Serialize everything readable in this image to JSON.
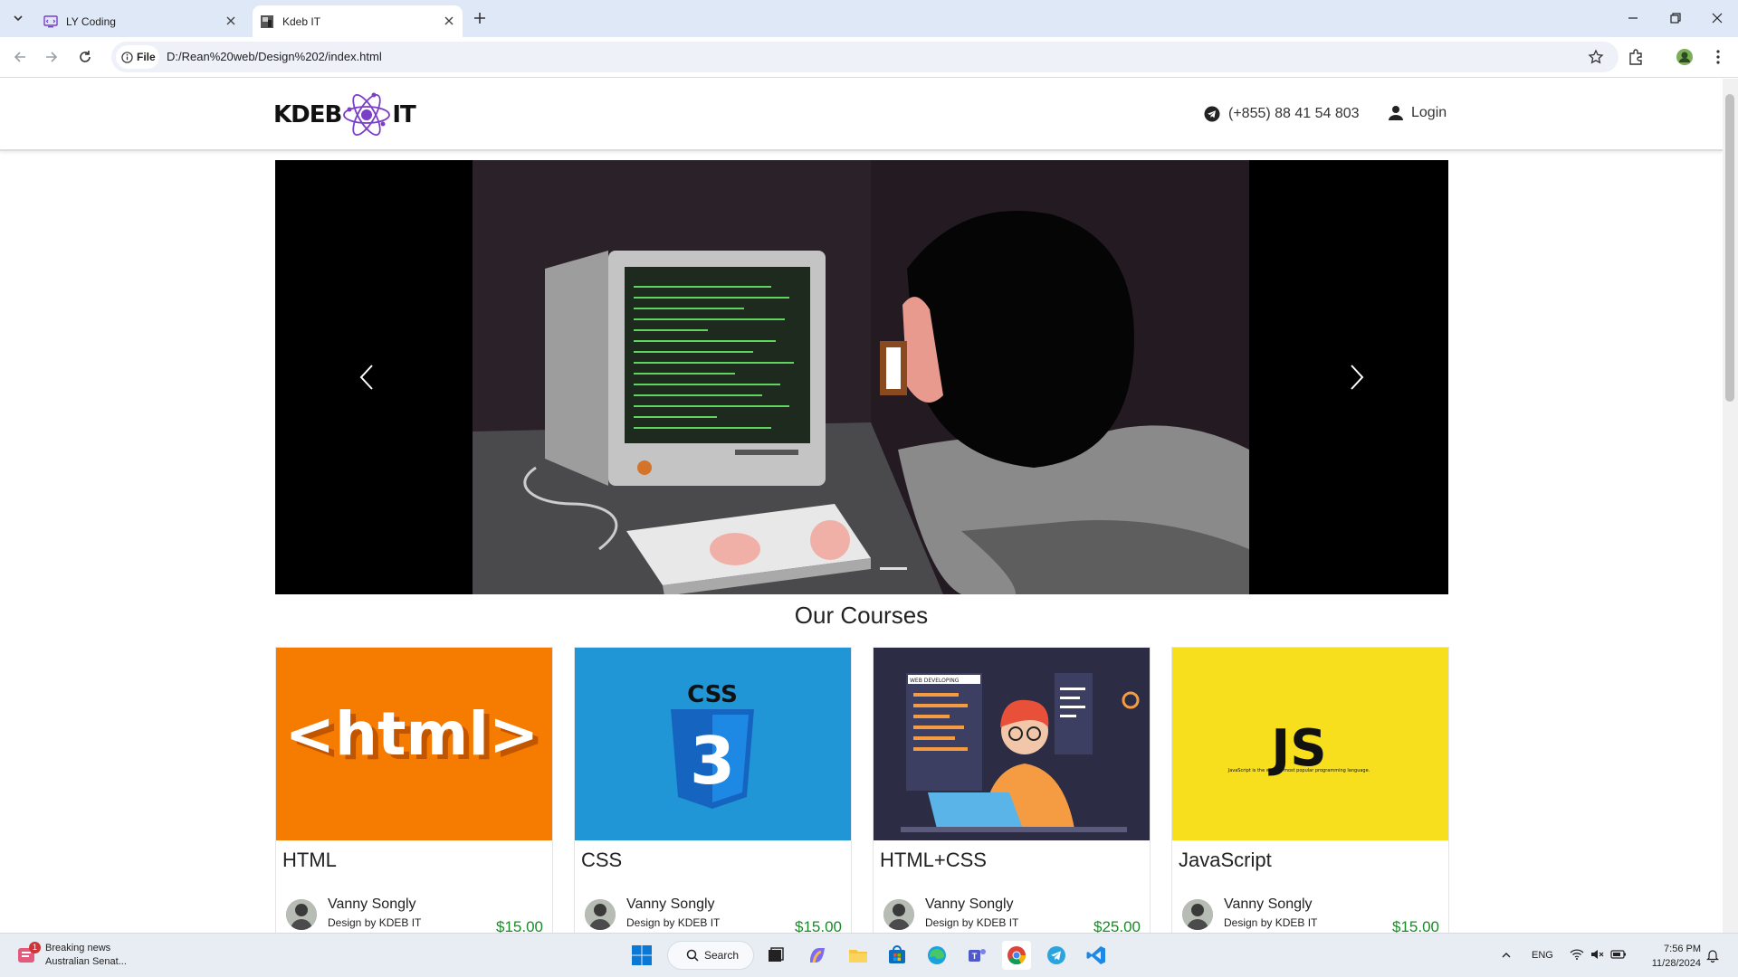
{
  "browser": {
    "tabs": [
      {
        "title": "LY Coding",
        "active": false
      },
      {
        "title": "Kdeb IT",
        "active": true
      }
    ],
    "security_chip": "File",
    "url": "D:/Rean%20web/Design%202/index.html"
  },
  "site": {
    "logo_left": "KDEB",
    "logo_right": "IT",
    "phone": "(+855) 88 41 54 803",
    "login_label": "Login",
    "section_title": "Our Courses",
    "courses": [
      {
        "name": "HTML",
        "author": "Vanny Songly",
        "credit": "Design by KDEB IT",
        "price": "$15.00",
        "thumb_text": "<html>",
        "thumb_color": "#f57c00"
      },
      {
        "name": "CSS",
        "author": "Vanny Songly",
        "credit": "Design by KDEB IT",
        "price": "$15.00",
        "thumb_text": "CSS",
        "thumb_color": "#2196d6"
      },
      {
        "name": "HTML+CSS",
        "author": "Vanny Songly",
        "credit": "Design by KDEB IT",
        "price": "$25.00",
        "thumb_text": "WEB DEVELOPING",
        "thumb_color": "#2c2c44"
      },
      {
        "name": "JavaScript",
        "author": "Vanny Songly",
        "credit": "Design by KDEB IT",
        "price": "$15.00",
        "thumb_text": "JS",
        "thumb_caption": "JavaScript is the world's most popular programming language.",
        "thumb_color": "#f7df1e"
      }
    ]
  },
  "taskbar": {
    "news_title": "Breaking news",
    "news_sub": "Australian Senat...",
    "news_badge": "1",
    "search_label": "Search",
    "lang": "ENG",
    "time": "7:56 PM",
    "date": "11/28/2024"
  },
  "colors": {
    "accent_purple": "#7a3ec8",
    "price_green": "#1a8a2a"
  }
}
